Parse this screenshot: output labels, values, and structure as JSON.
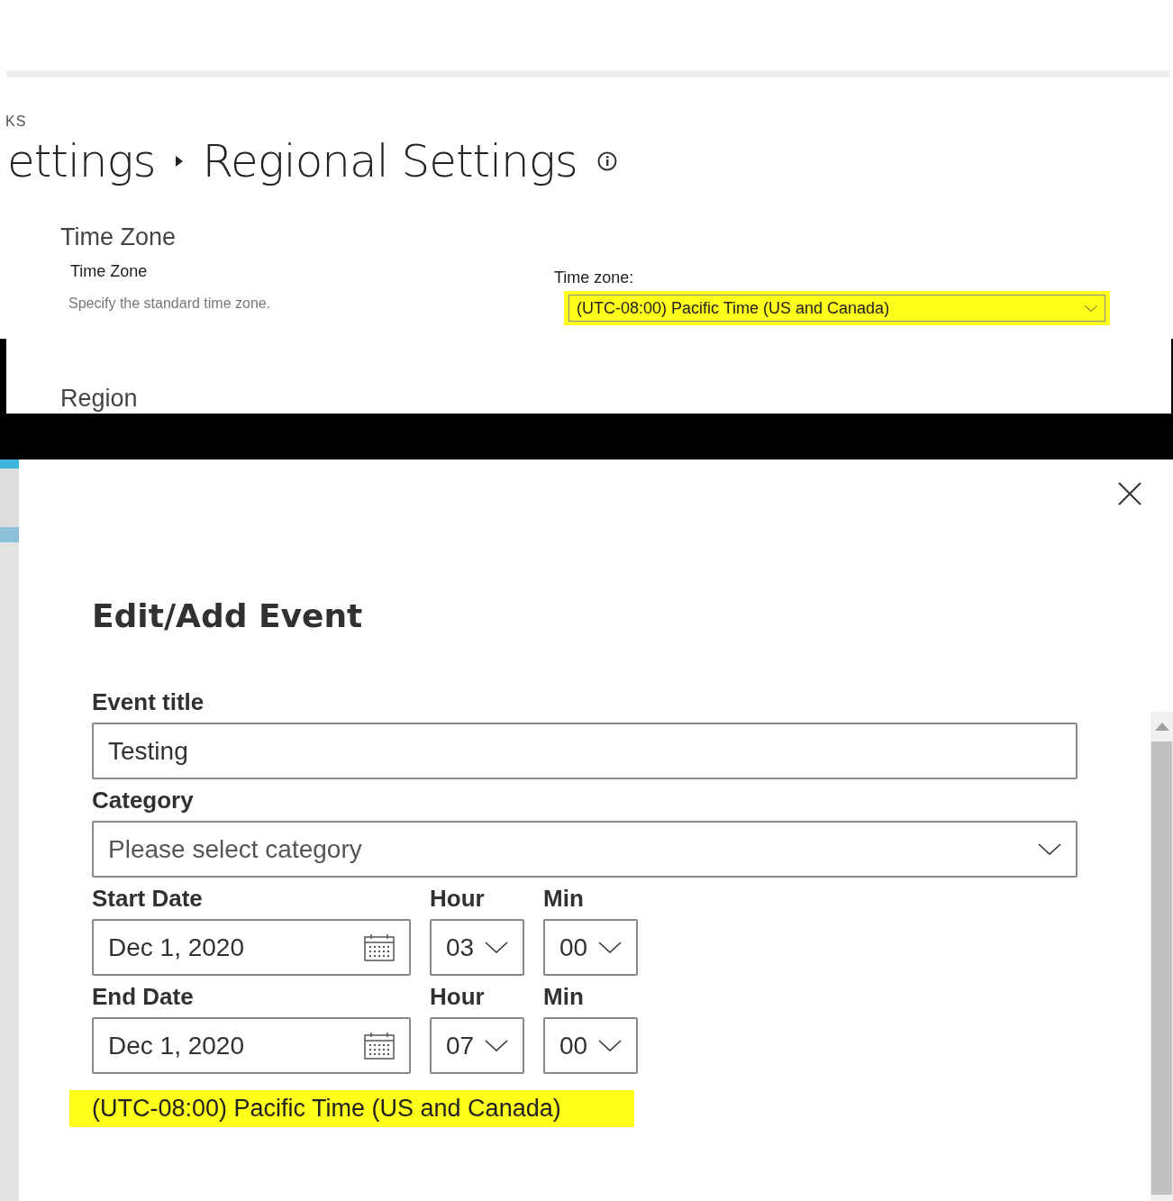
{
  "breadcrumb": "KS",
  "page_title": {
    "parent": "ettings",
    "current": "Regional Settings"
  },
  "section": {
    "title": "Time Zone",
    "field_title": "Time Zone",
    "description": "Specify the standard time zone.",
    "label": "Time zone:",
    "select_value": "(UTC-08:00) Pacific Time (US and Canada)",
    "highlighted": true
  },
  "next_section": "Region",
  "dialog": {
    "title": "Edit/Add Event",
    "fields": [
      {
        "kind": "text",
        "label": "Event title",
        "value": "Testing"
      },
      {
        "kind": "select",
        "label": "Category",
        "placeholder": "Please select category"
      }
    ],
    "time_rows": [
      {
        "date_label": "Start Date",
        "date": "Dec 1, 2020",
        "hour_label": "Hour",
        "hour": "03",
        "min_label": "Min",
        "min": "00"
      },
      {
        "date_label": "End Date",
        "date": "Dec 1, 2020",
        "hour_label": "Hour",
        "hour": "07",
        "min_label": "Min",
        "min": "00"
      }
    ],
    "timezone_note": {
      "text": "(UTC-08:00) Pacific Time (US and Canada)",
      "highlighted": true
    }
  }
}
